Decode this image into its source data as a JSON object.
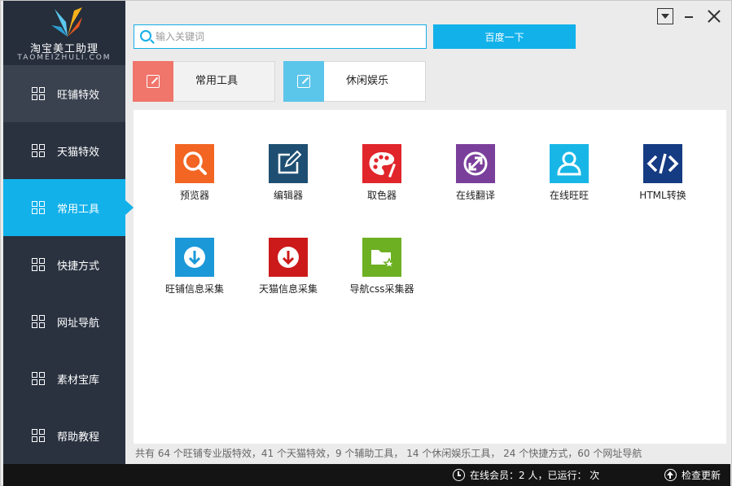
{
  "app": {
    "title": "淘宝美工助理",
    "subtitle": "TAOMEIZHULI.COM"
  },
  "sidebar": {
    "items": [
      {
        "label": "旺铺特效",
        "icon": "grid-icon"
      },
      {
        "label": "天猫特效",
        "icon": "grid-icon"
      },
      {
        "label": "常用工具",
        "icon": "grid-icon",
        "active": true
      },
      {
        "label": "快捷方式",
        "icon": "grid-icon"
      },
      {
        "label": "网址导航",
        "icon": "grid-icon"
      },
      {
        "label": "素材宝库",
        "icon": "grid-icon"
      },
      {
        "label": "帮助教程",
        "icon": "grid-icon"
      }
    ]
  },
  "search": {
    "placeholder": "输入关键词",
    "value": "",
    "button_label": "百度一下"
  },
  "categories": [
    {
      "label": "常用工具",
      "icon": "edit-icon",
      "color": "#f0756b"
    },
    {
      "label": "休闲娱乐",
      "icon": "edit-icon",
      "color": "#5cc5ea"
    }
  ],
  "tools": [
    {
      "label": "预览器",
      "icon": "magnifier-icon",
      "color": "#f26522"
    },
    {
      "label": "编辑器",
      "icon": "edit-icon",
      "color": "#1e4f72"
    },
    {
      "label": "取色器",
      "icon": "palette-icon",
      "color": "#e0252b"
    },
    {
      "label": "在线翻译",
      "icon": "translate-icon",
      "color": "#7a3f9b"
    },
    {
      "label": "在线旺旺",
      "icon": "user-icon",
      "color": "#18b6e6"
    },
    {
      "label": "HTML转换",
      "icon": "code-icon",
      "color": "#153b82"
    },
    {
      "label": "旺铺信息采集",
      "icon": "download-icon",
      "color": "#1a98d8"
    },
    {
      "label": "天猫信息采集",
      "icon": "download-icon",
      "color": "#cc1a1a"
    },
    {
      "label": "导航css采集器",
      "icon": "folder-star-icon",
      "color": "#6db022"
    }
  ],
  "footer": {
    "stats": "共有 64 个旺铺专业版特效，41 个天猫特效，9 个辅助工具， 14 个休闲娱乐工具， 24 个快捷方式，60 个网址导航",
    "online": "在线会员：2 人，已运行： 次",
    "update_label": "检查更新"
  }
}
